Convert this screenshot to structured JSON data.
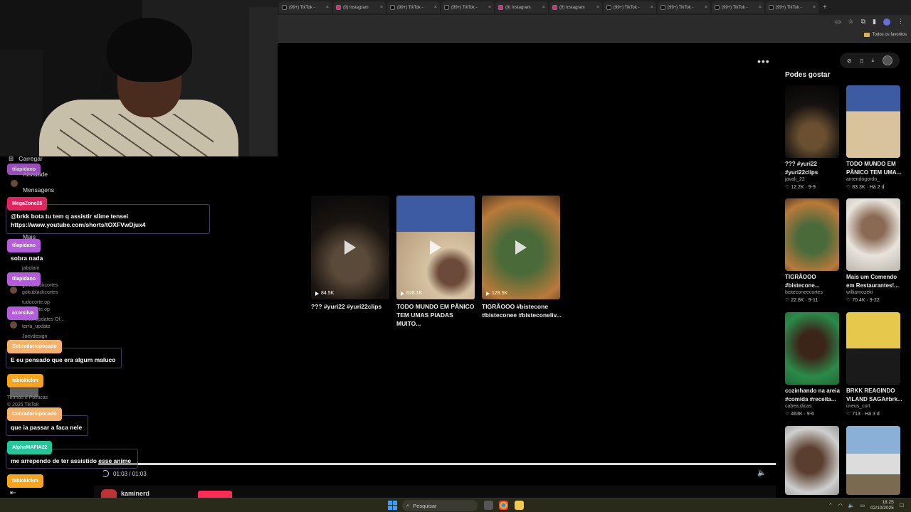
{
  "browser": {
    "tabs": [
      {
        "label": "(99+) TikTok -",
        "color": "#111"
      },
      {
        "label": "(9) Instagram",
        "color": "#d62976"
      },
      {
        "label": "(99+) TikTok -",
        "color": "#111"
      },
      {
        "label": "(99+) TikTok -",
        "color": "#111"
      },
      {
        "label": "(9) Instagram",
        "color": "#d62976"
      },
      {
        "label": "(9) Instagram",
        "color": "#d62976"
      },
      {
        "label": "(99+) TikTok -",
        "color": "#111"
      },
      {
        "label": "(99+) TikTok -",
        "color": "#111"
      },
      {
        "label": "(99+) TikTok -",
        "color": "#111"
      },
      {
        "label": "(99+) TikTok -",
        "color": "#111"
      }
    ],
    "bookmarks_label": "Todos os favoritos"
  },
  "player": {
    "videos": [
      {
        "views": "84.5K",
        "title": "??? #yuri22 #yuri22clips"
      },
      {
        "views": "628.1K",
        "title": "TODO MUNDO EM PÂNICO TEM UMAS PIADAS MUITO..."
      },
      {
        "views": "128.5K",
        "title": "TIGRÃOOO #bistecone #bisteconee #bisteconeliv..."
      }
    ],
    "time": "01:03 / 01:03",
    "username": "kaminerd"
  },
  "right_panel": {
    "title": "Podes gostar",
    "items": [
      {
        "title": "??? #yuri22 #yuri22clips",
        "author": "javali_22",
        "stats": "♡ 12.2K · 9-9"
      },
      {
        "title": "TODO MUNDO EM PÂNICO TEM UMA...",
        "author": "amendogordo_",
        "stats": "♡ 83.3K · Há 2 d"
      },
      {
        "title": "TIGRÃOOO #bistecone...",
        "author": "bisteconeecortes",
        "stats": "♡ 22.8K · 9-11"
      },
      {
        "title": "Mais um Comendo em Restaurantes!...",
        "author": "williamozeki",
        "stats": "♡ 70.4K · 9-22"
      },
      {
        "title": "cozinhando na areia #comida #receita...",
        "author": "cabea.dicas",
        "stats": "♡ 463K · 9-6"
      },
      {
        "title": "BRKK REAGINDO VILAND SAGA#brk...",
        "author": "iineus_cort",
        "stats": "♡ 713 · Há 3 d"
      }
    ]
  },
  "sidebar": {
    "carregar": "Carregar",
    "atividade": "Atividade",
    "mensagens": "Mensagens",
    "mais": "Mais",
    "ghosts": [
      "jabulani",
      "jabulanii",
      "gokublackcortes",
      "gokublackcortes",
      "tudocorte.op",
      "tudocorte.op",
      "Terra Updates Of...",
      "terra_update",
      "Joeydesign",
      "Termos e Políticas",
      "© 2025 TikTok"
    ]
  },
  "chat": [
    {
      "user": "tilapidano",
      "text": ""
    },
    {
      "user": "MegaZone26",
      "text": "@brkk bota tu tem q assistir slime tensei https://www.youtube.com/shorts/tOXFVwDjux4"
    },
    {
      "user": "tilapidano",
      "text": "sobra nada"
    },
    {
      "user": "tilapidano",
      "text": ""
    },
    {
      "user": "axorsilva",
      "text": ""
    },
    {
      "user": "Cobradoriopocado",
      "text": "E eu pensado que era algum maluco"
    },
    {
      "user": "fabiokickm",
      "text": ""
    },
    {
      "user": "Cobradoriopocado",
      "text": "que ia passar a faca nele"
    },
    {
      "user": "AlphaMAFIA22",
      "text": "me arrependo de ter assistido esse anime"
    },
    {
      "user": "fabiokickm",
      "text": ""
    }
  ],
  "taskbar": {
    "search": "Pesquisar",
    "time": "18:25",
    "date": "02/10/2025"
  }
}
